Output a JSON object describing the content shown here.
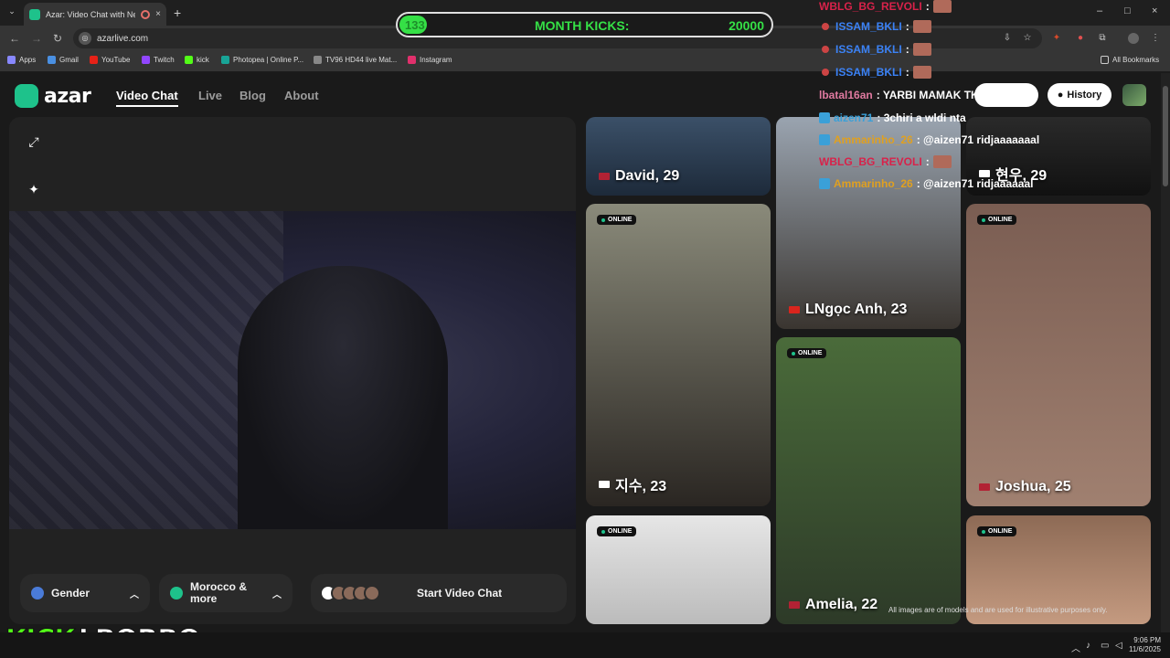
{
  "browser": {
    "tab_title": "Azar: Video Chat with New",
    "tab_close": "×",
    "new_tab": "+",
    "url": "azarlive.com",
    "window_controls": [
      "–",
      "□",
      "×"
    ],
    "bookmarks": [
      {
        "label": "Apps",
        "color": "#8888ff"
      },
      {
        "label": "Gmail",
        "color": "#4a90e2"
      },
      {
        "label": "YouTube",
        "color": "#e62117"
      },
      {
        "label": "Twitch",
        "color": "#9146ff"
      },
      {
        "label": "kick",
        "color": "#53fc18"
      },
      {
        "label": "Photopea | Online P...",
        "color": "#18a497"
      },
      {
        "label": "TV96 HD44 live Mat...",
        "color": "#888888"
      },
      {
        "label": "Instagram",
        "color": "#e1306c"
      }
    ],
    "all_bookmarks": "All Bookmarks"
  },
  "site": {
    "logo": "azar",
    "nav": [
      "Video Chat",
      "Live",
      "Blog",
      "About"
    ],
    "history": "History"
  },
  "controls": {
    "gender": "Gender",
    "region_line1": "Morocco &",
    "region_line2": "more",
    "start": "Start Video Chat"
  },
  "profiles": [
    {
      "name": "David, 29",
      "online": false,
      "flag": "#b22234",
      "bg": "linear-gradient(180deg,#3b5068,#1d2a3a)"
    },
    {
      "name": "LNgọc Anh, 23",
      "online": false,
      "flag": "#da251d",
      "bg": "linear-gradient(180deg,#9aa4b0,#3a3530)"
    },
    {
      "name": "현우, 29",
      "online": false,
      "flag": "#ffffff",
      "bg": "linear-gradient(180deg,#2a2a2a,#111)"
    },
    {
      "name": "지수, 23",
      "online": true,
      "flag": "#ffffff",
      "bg": "linear-gradient(180deg,#8a8a7a,#2a2622)"
    },
    {
      "name": "Joshua, 25",
      "online": true,
      "flag": "#b22234",
      "bg": "linear-gradient(180deg,#7a5d52,#a08070)"
    },
    {
      "name": "Amelia, 22",
      "online": true,
      "flag": "#b22234",
      "bg": "linear-gradient(180deg,#4a6b3a,#2d3a28)"
    },
    {
      "name": "",
      "online": true,
      "flag": "",
      "bg": "linear-gradient(180deg,#e6e6e6,#bbbbbb)"
    },
    {
      "name": "",
      "online": true,
      "flag": "",
      "bg": "linear-gradient(180deg,#8d6a55,#c49a80)"
    }
  ],
  "online_label": "ONLINE",
  "disclaimer": "All images are of models and are used for illustrative purposes only.",
  "stream": {
    "kicks_count": "133",
    "kicks_progress": 0.0067,
    "kicks_label": "MONTH KICKS:",
    "kicks_goal": "20000",
    "brand": "KICK",
    "username": "LBORBO",
    "chat": [
      {
        "user": "WBLG_BG_REVOLI",
        "color": "#d8224a",
        "text": ":",
        "thumb": true
      },
      {
        "user": "ISSAM_BKLI",
        "color": "#3b82f6",
        "text": ":",
        "thumb": true,
        "bullet": true
      },
      {
        "user": "ISSAM_BKLI",
        "color": "#3b82f6",
        "text": ":",
        "thumb": true,
        "bullet": true
      },
      {
        "user": "ISSAM_BKLI",
        "color": "#3b82f6",
        "text": ":",
        "thumb": true,
        "bullet": true
      },
      {
        "user": "lbatal16an",
        "color": "#e07aa0",
        "text": ": YARBI MAMAK TKHSHA LIK"
      },
      {
        "user": "aizen71",
        "color": "#3aa0d8",
        "text": ": 3chiri a wldi nta",
        "shield": true
      },
      {
        "user": "Ammarinho_26",
        "color": "#e0a020",
        "text": ": @aizen71 ridjaaaaaaal",
        "shield": true
      },
      {
        "user": "WBLG_BG_REVOLI",
        "color": "#d8224a",
        "text": ":",
        "thumb": true
      },
      {
        "user": "Ammarinho_26",
        "color": "#e0a020",
        "text": ": @aizen71 ridjaaaaaal",
        "shield": true
      }
    ]
  },
  "taskbar": {
    "time": "9:06 PM",
    "date": "11/6/2025"
  }
}
